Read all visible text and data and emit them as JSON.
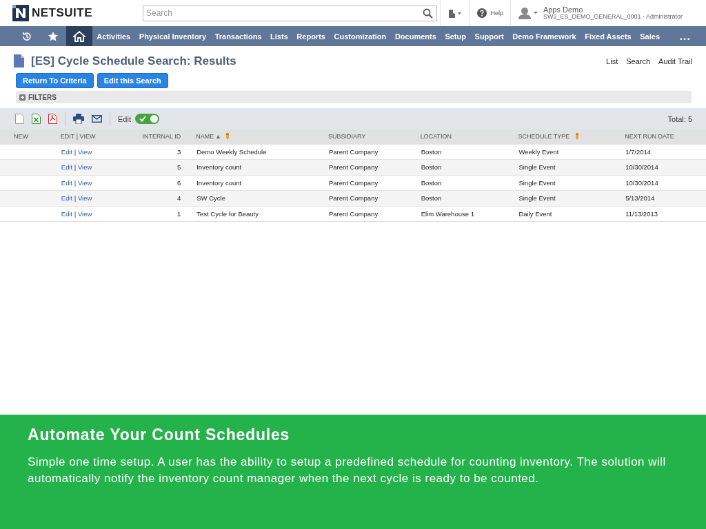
{
  "header": {
    "logo": "NETSUITE",
    "search": {
      "placeholder": "Search"
    },
    "help": "Help",
    "user": {
      "name": "Apps Demo",
      "role": "SW2_ES_DEMO_GENERAL_0001 - Administrator"
    }
  },
  "nav": {
    "icons": [
      {
        "kind": "recent",
        "selected": false
      },
      {
        "kind": "favorites",
        "selected": false
      },
      {
        "kind": "home",
        "selected": true
      }
    ],
    "items": [
      {
        "label": "Activities",
        "selected": false
      },
      {
        "label": "Physical Inventory",
        "selected": false
      },
      {
        "label": "Transactions",
        "selected": false
      },
      {
        "label": "Lists",
        "selected": false
      },
      {
        "label": "Reports",
        "selected": false
      },
      {
        "label": "Customization",
        "selected": false
      },
      {
        "label": "Documents",
        "selected": false
      },
      {
        "label": "Setup",
        "selected": false
      },
      {
        "label": "Support",
        "selected": false
      },
      {
        "label": "Demo Framework",
        "selected": false
      },
      {
        "label": "Fixed Assets",
        "selected": false
      },
      {
        "label": "Sales",
        "selected": false
      }
    ],
    "more": "..."
  },
  "page": {
    "title": "[ES] Cycle Schedule Search: Results",
    "links": [
      "List",
      "Search",
      "Audit Trail"
    ],
    "buttons": [
      "Return To Criteria",
      "Edit this Search"
    ],
    "filters": {
      "label": "FILTERS",
      "expanded": false
    }
  },
  "toolbar": {
    "edit_label": "Edit",
    "edit_on": true,
    "total": "Total: 5"
  },
  "table": {
    "columns": [
      {
        "label": "NEW",
        "kind": "text",
        "sorted": false,
        "editable": false
      },
      {
        "label": "EDIT | VIEW",
        "kind": "text",
        "sorted": false,
        "editable": false
      },
      {
        "label": "INTERNAL ID",
        "kind": "number",
        "sorted": false,
        "editable": false
      },
      {
        "label": "NAME",
        "kind": "text",
        "sorted": true,
        "editable": true
      },
      {
        "label": "SUBSIDIARY",
        "kind": "text",
        "sorted": false,
        "editable": false
      },
      {
        "label": "LOCATION",
        "kind": "text",
        "sorted": false,
        "editable": false
      },
      {
        "label": "SCHEDULE TYPE",
        "kind": "text",
        "sorted": false,
        "editable": true
      },
      {
        "label": "NEXT RUN DATE",
        "kind": "text",
        "sorted": false,
        "editable": false
      }
    ],
    "rows": [
      {
        "edit": "Edit",
        "separator": "|",
        "view": "View",
        "internal_id": "3",
        "name": "Demo Weekly Schedule",
        "subsidiary": "Parent Company",
        "location": "Boston",
        "schedule_type": "Weekly Event",
        "next_run_date": "1/7/2014"
      },
      {
        "edit": "Edit",
        "separator": "|",
        "view": "View",
        "internal_id": "5",
        "name": "Inventory count",
        "subsidiary": "Parent Company",
        "location": "Boston",
        "schedule_type": "Single Event",
        "next_run_date": "10/30/2014"
      },
      {
        "edit": "Edit",
        "separator": "|",
        "view": "View",
        "internal_id": "6",
        "name": "Inventory count",
        "subsidiary": "Parent Company",
        "location": "Boston",
        "schedule_type": "Single Event",
        "next_run_date": "10/30/2014"
      },
      {
        "edit": "Edit",
        "separator": "|",
        "view": "View",
        "internal_id": "4",
        "name": "SW Cycle",
        "subsidiary": "Parent Company",
        "location": "Boston",
        "schedule_type": "Single Event",
        "next_run_date": "5/13/2014"
      },
      {
        "edit": "Edit",
        "separator": "|",
        "view": "View",
        "internal_id": "1",
        "name": "Test Cycle for Beauty",
        "subsidiary": "Parent Company",
        "location": "Elim Warehouse 1",
        "schedule_type": "Daily Event",
        "next_run_date": "11/13/2013"
      }
    ]
  },
  "banner": {
    "title": "Automate Your Count Schedules",
    "text": "Simple one time setup. A user has the ability to setup a predefined schedule for counting inventory. The solution will automatically notify the inventory count manager when the next cycle is ready to be counted."
  }
}
